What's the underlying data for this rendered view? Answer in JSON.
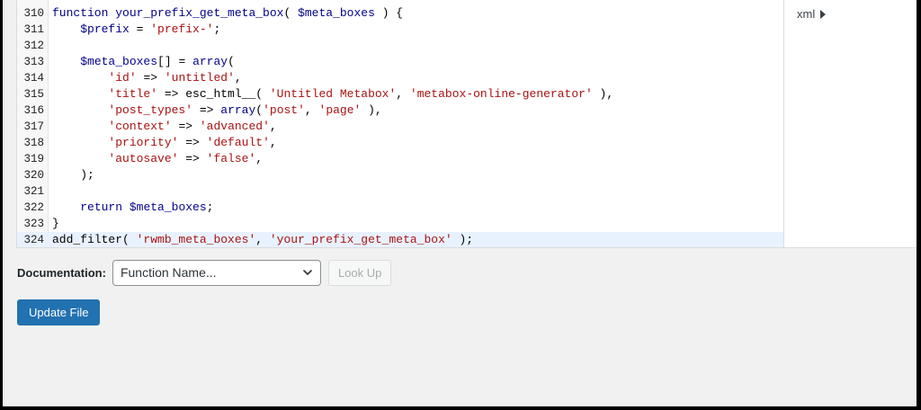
{
  "editor": {
    "lines": [
      {
        "num": "310",
        "html": "<span class=\"kw\">function</span> <span class=\"fn\">your_prefix_get_meta_box</span>( <span class=\"var\">$meta_boxes</span> ) {"
      },
      {
        "num": "311",
        "html": "    <span class=\"var\">$prefix</span> = <span class=\"str\">'prefix-'</span>;"
      },
      {
        "num": "312",
        "html": ""
      },
      {
        "num": "313",
        "html": "    <span class=\"var\">$meta_boxes</span>[] = <span class=\"kw\">array</span>("
      },
      {
        "num": "314",
        "html": "        <span class=\"str\">'id'</span> => <span class=\"str\">'untitled'</span>,"
      },
      {
        "num": "315",
        "html": "        <span class=\"str\">'title'</span> => esc_html__( <span class=\"str\">'Untitled Metabox'</span>, <span class=\"str\">'metabox-online-generator'</span> ),"
      },
      {
        "num": "316",
        "html": "        <span class=\"str\">'post_types'</span> => <span class=\"kw\">array</span>(<span class=\"str\">'post'</span>, <span class=\"str\">'page'</span> ),"
      },
      {
        "num": "317",
        "html": "        <span class=\"str\">'context'</span> => <span class=\"str\">'advanced'</span>,"
      },
      {
        "num": "318",
        "html": "        <span class=\"str\">'priority'</span> => <span class=\"str\">'default'</span>,"
      },
      {
        "num": "319",
        "html": "        <span class=\"str\">'autosave'</span> => <span class=\"str\">'false'</span>,"
      },
      {
        "num": "320",
        "html": "    );"
      },
      {
        "num": "321",
        "html": ""
      },
      {
        "num": "322",
        "html": "    <span class=\"kw\">return</span> <span class=\"var\">$meta_boxes</span>;"
      },
      {
        "num": "323",
        "html": "}"
      },
      {
        "num": "324",
        "html": "add_filter( <span class=\"str\">'rwmb_meta_boxes'</span>, <span class=\"str\">'your_prefix_get_meta_box'</span> );",
        "active": true
      }
    ]
  },
  "file_list": {
    "item": "xml"
  },
  "documentation": {
    "label": "Documentation:",
    "select_value": "Function Name...",
    "lookup_label": "Look Up"
  },
  "update_label": "Update File"
}
